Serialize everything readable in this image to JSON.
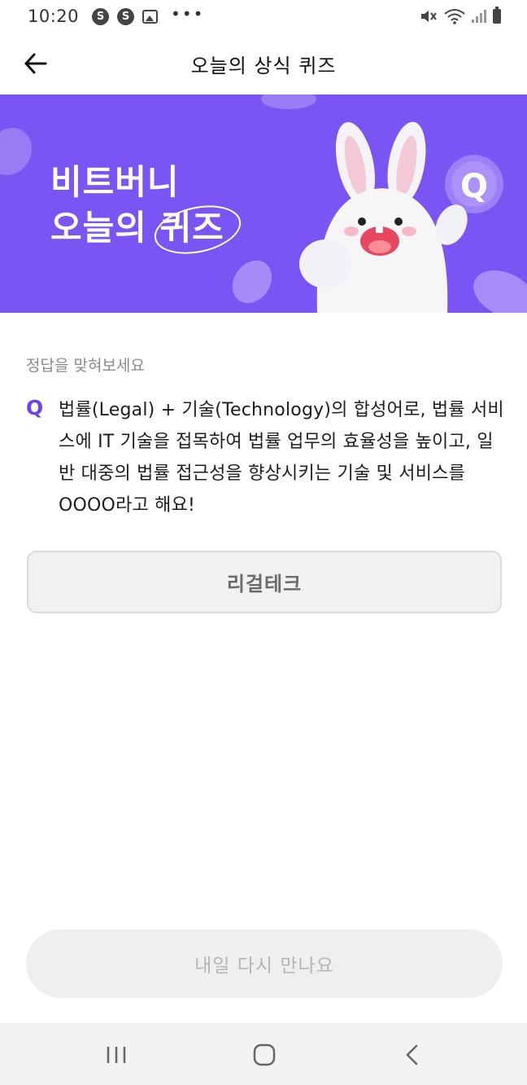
{
  "status_bar": {
    "time": "10:20",
    "icons": [
      "s-circle-icon",
      "s-circle-icon",
      "image-icon",
      "more-dots-icon",
      "mute-icon",
      "wifi-icon",
      "signal-icon",
      "battery-icon"
    ],
    "notification_glyph": "S",
    "dots": "•••"
  },
  "header": {
    "title": "오늘의 상식 퀴즈",
    "back_icon": "arrow-left-icon"
  },
  "banner": {
    "line1": "비트버니",
    "line2_prefix": "오늘의 ",
    "line2_highlight": "퀴즈",
    "background_color": "#7a55f4",
    "badge_letter": "Q"
  },
  "quiz": {
    "prompt_label": "정답을 맞혀보세요",
    "q_mark": "Q",
    "question_text": "법률(Legal) + 기술(Technology)의 합성어로, 법률 서비스에 IT 기술을 접목하여 법률 업무의 효율성을 높이고, 일반 대중의 법률 접근성을 향상시키는 기술 및 서비스를 OOOO라고 해요!",
    "answer": "리걸테크",
    "accent_color": "#6d43e8"
  },
  "bottom_button": {
    "label": "내일 다시 만나요"
  },
  "nav_bar": {
    "icons": [
      "recent-apps-icon",
      "home-icon",
      "back-nav-icon"
    ]
  }
}
